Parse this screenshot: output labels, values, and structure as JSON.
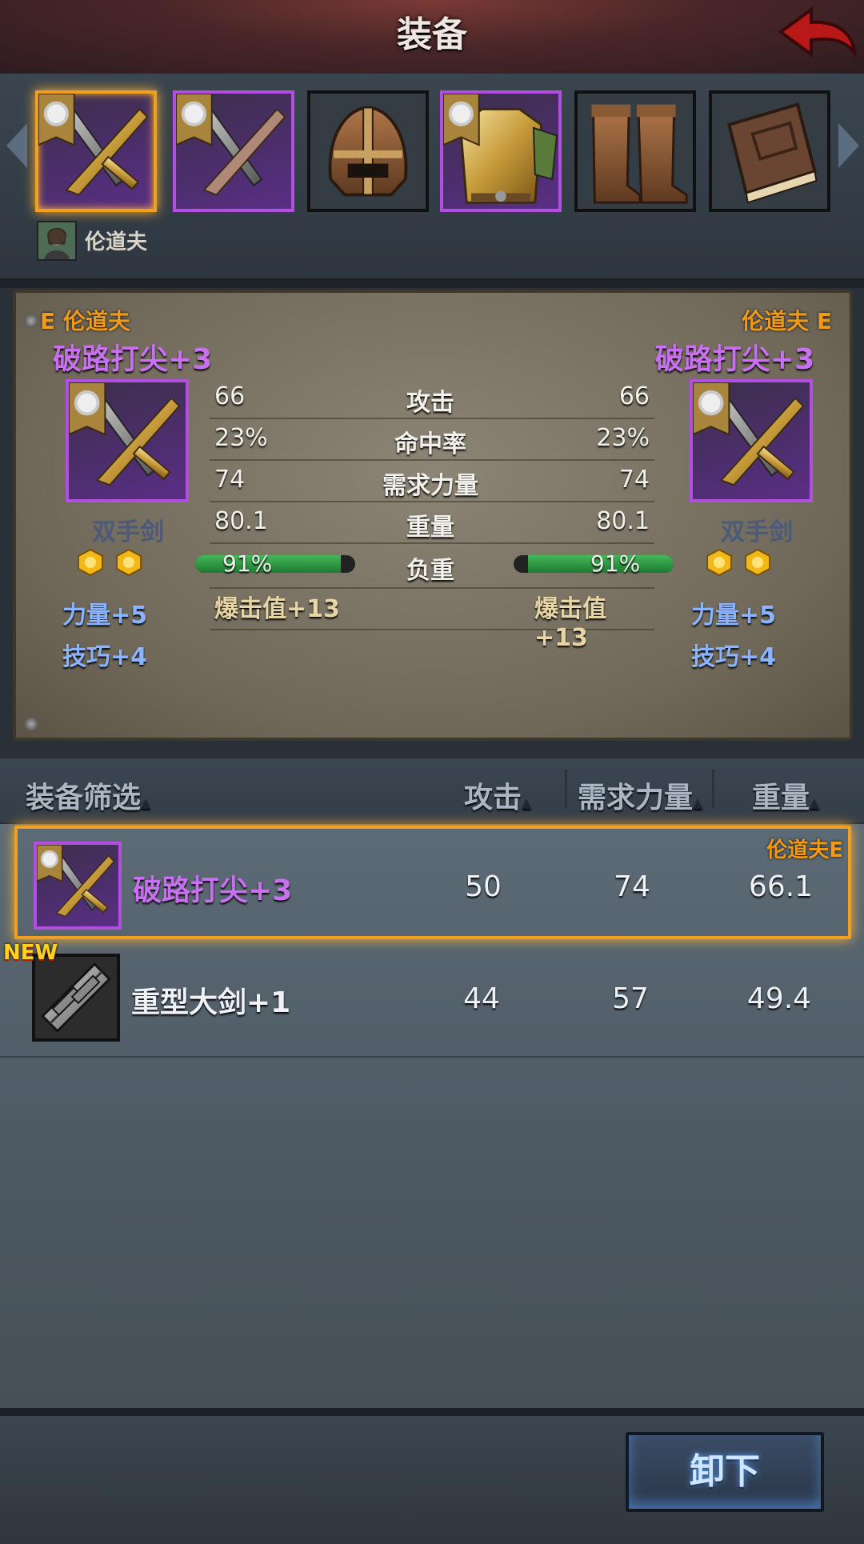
{
  "header": {
    "title": "装备",
    "back_icon": "red-back-arrow-icon"
  },
  "slots": [
    {
      "name": "sword-slot",
      "frame": "purple",
      "selected": true,
      "badge": true
    },
    {
      "name": "sword-slot-2",
      "frame": "purple",
      "selected": false,
      "badge": true
    },
    {
      "name": "helmet-slot",
      "frame": "plain",
      "selected": false,
      "badge": false
    },
    {
      "name": "armor-slot",
      "frame": "purple",
      "selected": false,
      "badge": true
    },
    {
      "name": "boots-slot",
      "frame": "plain",
      "selected": false,
      "badge": false
    },
    {
      "name": "book-slot",
      "frame": "plain",
      "selected": false,
      "badge": false
    }
  ],
  "character": {
    "name": "伦道夫"
  },
  "compare": {
    "left": {
      "owner": "E 伦道夫",
      "item_name": "破路打尖+3",
      "type": "双手剑",
      "bonuses": [
        "力量+5",
        "技巧+4"
      ],
      "crit": "爆击值+13"
    },
    "right": {
      "owner": "伦道夫 E",
      "item_name": "破路打尖+3",
      "type": "双手剑",
      "bonuses": [
        "力量+5",
        "技巧+4"
      ],
      "crit": "爆击值+13"
    },
    "stats": [
      {
        "label": "攻击",
        "left": "66",
        "right": "66"
      },
      {
        "label": "命中率",
        "left": "23%",
        "right": "23%"
      },
      {
        "label": "需求力量",
        "left": "74",
        "right": "74"
      },
      {
        "label": "重量",
        "left": "80.1",
        "right": "80.1"
      }
    ],
    "load": {
      "label": "负重",
      "left": "91%",
      "right": "91%",
      "left_fill": 0.91,
      "right_fill": 0.91
    }
  },
  "list": {
    "headers": {
      "filter": "装备筛选",
      "attack": "攻击",
      "strength": "需求力量",
      "weight": "重量"
    },
    "rows": [
      {
        "name": "破路打尖+3",
        "attack": "50",
        "strength": "74",
        "weight": "66.1",
        "owner": "伦道夫E",
        "selected": true,
        "is_new": false,
        "color": "#c870f0"
      },
      {
        "name": "重型大剑+1",
        "attack": "44",
        "strength": "57",
        "weight": "49.4",
        "owner": "",
        "selected": false,
        "is_new": true,
        "new_label": "NEW",
        "color": "#eef2f6"
      }
    ]
  },
  "footer": {
    "unequip_label": "卸下"
  },
  "colors": {
    "accent_orange": "#f09a1a",
    "purple_rarity": "#b24fe0",
    "bonus_blue": "#8ab4ff"
  }
}
